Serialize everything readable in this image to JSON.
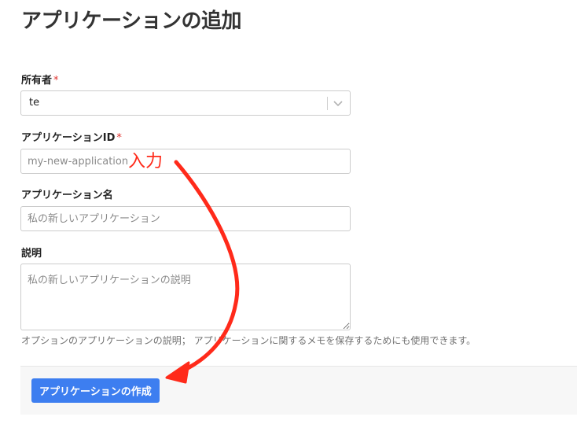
{
  "page": {
    "title": "アプリケーションの追加"
  },
  "owner": {
    "label": "所有者",
    "required_mark": "*",
    "value": "te"
  },
  "app_id": {
    "label": "アプリケーションID",
    "required_mark": "*",
    "placeholder": "my-new-application"
  },
  "app_name": {
    "label": "アプリケーション名",
    "placeholder": "私の新しいアプリケーション"
  },
  "description": {
    "label": "説明",
    "placeholder": "私の新しいアプリケーションの説明",
    "help": "オプションのアプリケーションの説明； アプリケーションに関するメモを保存するためにも使用できます。"
  },
  "actions": {
    "create_label": "アプリケーションの作成"
  },
  "annotation": {
    "text": "入力",
    "color": "#ff2a1a"
  },
  "colors": {
    "primary": "#3d7ef0",
    "required": "#e0322e"
  },
  "icons": {
    "select": "chevron-down-icon",
    "annotation": "curved-arrow-icon"
  }
}
